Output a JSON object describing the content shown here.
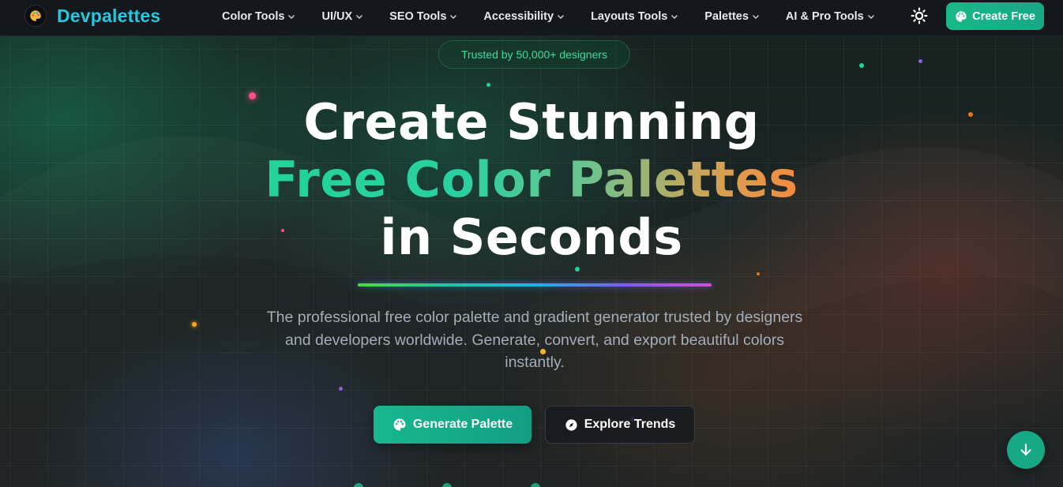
{
  "brand": {
    "name": "Devpalettes",
    "logo_icon": "palette-logo-icon"
  },
  "nav": {
    "items": [
      {
        "label": "Color Tools"
      },
      {
        "label": "UI/UX"
      },
      {
        "label": "SEO Tools"
      },
      {
        "label": "Accessibility"
      },
      {
        "label": "Layouts Tools"
      },
      {
        "label": "Palettes"
      },
      {
        "label": "AI & Pro Tools"
      }
    ],
    "theme_icon": "sun-icon",
    "cta_label": "Create Free"
  },
  "hero": {
    "badge": "Trusted by 50,000+ designers",
    "headline_line1": "Create Stunning",
    "headline_line2": "Free Color Palettes",
    "headline_line3": "in Seconds",
    "subtitle": "The professional free color palette and gradient generator trusted by designers and developers worldwide. Generate, convert, and export beautiful colors instantly.",
    "primary_button": "Generate Palette",
    "secondary_button": "Explore Trends"
  },
  "colors": {
    "accent": "#19b88a",
    "brand_text": "#29c7dd",
    "badge_text": "#3fdc9b",
    "gradient_start": "#21d39a",
    "gradient_end": "#f58b3e"
  }
}
